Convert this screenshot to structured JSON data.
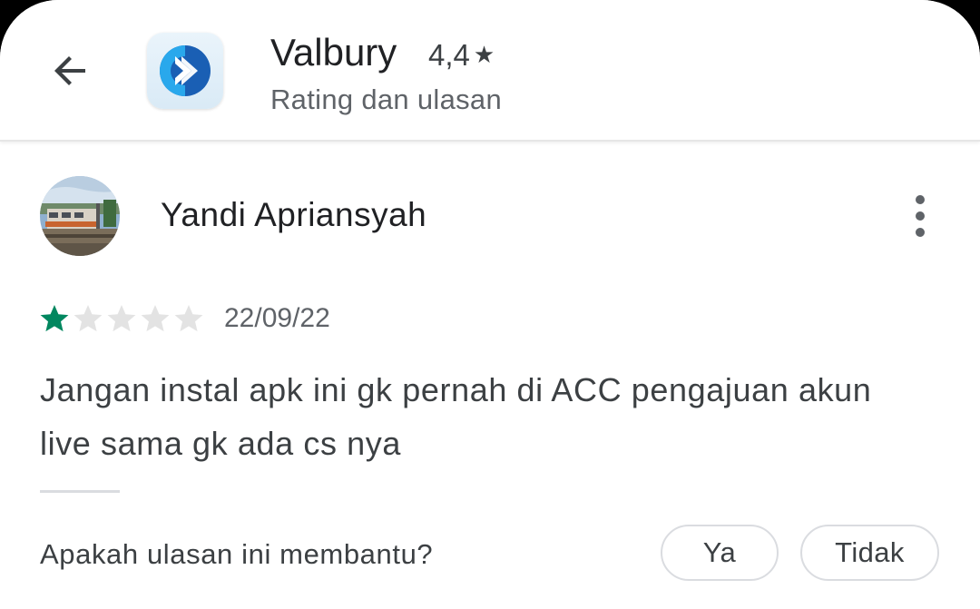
{
  "header": {
    "app_name": "Valbury",
    "app_rating": "4,4",
    "rating_star": "★",
    "subtitle": "Rating dan ulasan",
    "back_icon": "arrow-back-icon",
    "app_icon": "valbury-logo-icon"
  },
  "review": {
    "reviewer_name": "Yandi Apriansyah",
    "rating_stars": 1,
    "max_stars": 5,
    "date": "22/09/22",
    "text": "Jangan instal apk ini gk pernah di ACC pengajuan akun live sama gk ada cs nya",
    "more_icon": "more-vert-icon"
  },
  "helpful": {
    "question": "Apakah ulasan ini membantu?",
    "yes_label": "Ya",
    "no_label": "Tidak"
  },
  "colors": {
    "star_filled": "#01875f",
    "star_empty": "#e3e3e3",
    "app_icon_blue": "#1a6fc8",
    "app_icon_light_blue": "#29a8ec"
  }
}
